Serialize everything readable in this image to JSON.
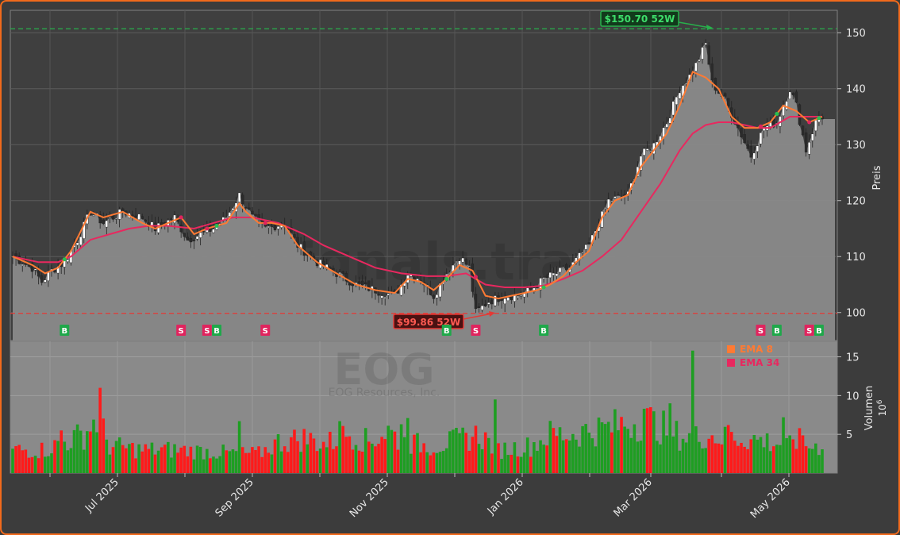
{
  "chart_data": {
    "type": "candlestick",
    "price_axis": {
      "label": "Preis",
      "ylim": [
        95,
        154
      ],
      "ticks": [
        100,
        110,
        120,
        130,
        140,
        150
      ]
    },
    "volume_axis": {
      "label": "Volumen",
      "exponent": "10",
      "exponent_power": "6",
      "ylim": [
        0,
        17
      ],
      "ticks": [
        5,
        10,
        15
      ]
    },
    "x_ticks": [
      "Jul 2025",
      "Sep 2025",
      "Nov 2025",
      "Jan 2026",
      "Mar 2026",
      "May 2026"
    ],
    "levels": {
      "high_52w": {
        "value": 150.7,
        "label": "$150.70 52W"
      },
      "low_52w": {
        "value": 99.86,
        "label": "$99.86 52W"
      }
    },
    "legend": [
      {
        "name": "EMA 8",
        "color": "#ff7a33"
      },
      {
        "name": "EMA 34",
        "color": "#e8285f"
      }
    ],
    "watermark": {
      "site": "forexsignals.trade",
      "ticker": "EOG",
      "company": "EOG Resources, Inc."
    },
    "signals": [
      {
        "type": "B",
        "index": 16
      },
      {
        "type": "S",
        "index": 52
      },
      {
        "type": "S",
        "index": 60
      },
      {
        "type": "B",
        "index": 63
      },
      {
        "type": "S",
        "index": 78
      },
      {
        "type": "B",
        "index": 134
      },
      {
        "type": "S",
        "index": 143
      },
      {
        "type": "B",
        "index": 164
      },
      {
        "type": "S",
        "index": 231
      },
      {
        "type": "B",
        "index": 236
      },
      {
        "type": "S",
        "index": 246
      },
      {
        "type": "B",
        "index": 249
      }
    ],
    "close_anchors": [
      [
        0,
        110
      ],
      [
        6,
        108
      ],
      [
        9,
        105.5
      ],
      [
        12,
        107.5
      ],
      [
        16,
        109
      ],
      [
        20,
        113
      ],
      [
        24,
        118
      ],
      [
        28,
        116
      ],
      [
        34,
        118
      ],
      [
        40,
        117
      ],
      [
        44,
        115
      ],
      [
        50,
        117
      ],
      [
        54,
        113
      ],
      [
        58,
        114
      ],
      [
        62,
        115
      ],
      [
        66,
        117
      ],
      [
        70,
        121
      ],
      [
        74,
        117
      ],
      [
        78,
        115
      ],
      [
        84,
        116
      ],
      [
        88,
        112
      ],
      [
        94,
        109
      ],
      [
        100,
        107
      ],
      [
        106,
        105
      ],
      [
        112,
        104
      ],
      [
        118,
        103
      ],
      [
        122,
        107
      ],
      [
        126,
        106
      ],
      [
        130,
        103
      ],
      [
        134,
        107
      ],
      [
        138,
        110
      ],
      [
        141,
        108
      ],
      [
        143,
        100
      ],
      [
        147,
        102
      ],
      [
        152,
        103
      ],
      [
        156,
        103
      ],
      [
        160,
        104
      ],
      [
        164,
        106
      ],
      [
        168,
        107
      ],
      [
        172,
        108
      ],
      [
        178,
        112
      ],
      [
        184,
        120
      ],
      [
        190,
        121
      ],
      [
        194,
        128
      ],
      [
        198,
        130
      ],
      [
        202,
        134
      ],
      [
        206,
        140
      ],
      [
        210,
        143
      ],
      [
        214,
        148
      ],
      [
        216,
        141
      ],
      [
        220,
        138
      ],
      [
        224,
        133
      ],
      [
        228,
        128
      ],
      [
        232,
        133
      ],
      [
        236,
        134
      ],
      [
        240,
        140
      ],
      [
        242,
        137
      ],
      [
        245,
        129
      ],
      [
        248,
        134
      ],
      [
        250,
        135
      ]
    ],
    "ema8": [
      [
        0,
        110
      ],
      [
        6,
        108.5
      ],
      [
        10,
        107
      ],
      [
        14,
        108
      ],
      [
        18,
        111
      ],
      [
        24,
        118
      ],
      [
        28,
        117
      ],
      [
        34,
        118
      ],
      [
        40,
        116
      ],
      [
        44,
        115
      ],
      [
        48,
        116
      ],
      [
        52,
        117
      ],
      [
        56,
        114
      ],
      [
        60,
        115
      ],
      [
        66,
        116
      ],
      [
        70,
        119.5
      ],
      [
        72,
        118
      ],
      [
        76,
        116
      ],
      [
        80,
        116
      ],
      [
        84,
        115.5
      ],
      [
        88,
        112
      ],
      [
        94,
        109
      ],
      [
        100,
        107
      ],
      [
        106,
        105
      ],
      [
        112,
        104
      ],
      [
        118,
        103.5
      ],
      [
        122,
        106
      ],
      [
        126,
        105.5
      ],
      [
        130,
        104
      ],
      [
        134,
        106
      ],
      [
        138,
        108.5
      ],
      [
        142,
        107.5
      ],
      [
        146,
        103
      ],
      [
        150,
        102.5
      ],
      [
        154,
        103
      ],
      [
        158,
        103.5
      ],
      [
        162,
        104
      ],
      [
        166,
        105
      ],
      [
        170,
        106.5
      ],
      [
        174,
        109
      ],
      [
        178,
        111
      ],
      [
        182,
        117
      ],
      [
        186,
        120
      ],
      [
        190,
        121
      ],
      [
        194,
        126
      ],
      [
        198,
        129
      ],
      [
        202,
        132
      ],
      [
        206,
        137
      ],
      [
        210,
        143
      ],
      [
        214,
        142
      ],
      [
        218,
        140
      ],
      [
        222,
        135
      ],
      [
        226,
        133
      ],
      [
        230,
        133
      ],
      [
        234,
        134
      ],
      [
        238,
        137
      ],
      [
        242,
        136
      ],
      [
        246,
        134
      ],
      [
        250,
        135
      ]
    ],
    "ema34": [
      [
        0,
        110
      ],
      [
        8,
        109
      ],
      [
        14,
        109
      ],
      [
        18,
        110
      ],
      [
        24,
        113
      ],
      [
        30,
        114
      ],
      [
        36,
        115
      ],
      [
        42,
        115.5
      ],
      [
        48,
        115.5
      ],
      [
        56,
        115
      ],
      [
        62,
        116
      ],
      [
        68,
        117
      ],
      [
        74,
        117
      ],
      [
        82,
        116
      ],
      [
        90,
        114
      ],
      [
        96,
        112
      ],
      [
        104,
        110
      ],
      [
        112,
        108
      ],
      [
        120,
        107
      ],
      [
        128,
        106.5
      ],
      [
        134,
        106.5
      ],
      [
        140,
        107
      ],
      [
        146,
        105
      ],
      [
        152,
        104.5
      ],
      [
        158,
        104.5
      ],
      [
        164,
        104.8
      ],
      [
        170,
        106
      ],
      [
        176,
        107.5
      ],
      [
        182,
        110
      ],
      [
        188,
        113
      ],
      [
        194,
        118
      ],
      [
        200,
        123
      ],
      [
        206,
        129
      ],
      [
        210,
        132
      ],
      [
        214,
        133.5
      ],
      [
        218,
        134
      ],
      [
        222,
        134
      ],
      [
        226,
        133.5
      ],
      [
        230,
        133
      ],
      [
        234,
        133
      ],
      [
        240,
        135
      ],
      [
        246,
        135
      ],
      [
        250,
        135
      ]
    ],
    "volume_anchors": [
      [
        0,
        3
      ],
      [
        10,
        3
      ],
      [
        16,
        4
      ],
      [
        22,
        5
      ],
      [
        26,
        7
      ],
      [
        30,
        3.5
      ],
      [
        40,
        3
      ],
      [
        50,
        3
      ],
      [
        60,
        2.8
      ],
      [
        70,
        2.5
      ],
      [
        76,
        2.5
      ],
      [
        82,
        4
      ],
      [
        90,
        4.5
      ],
      [
        96,
        3.8
      ],
      [
        100,
        4.2
      ],
      [
        104,
        5.2
      ],
      [
        110,
        4
      ],
      [
        116,
        5.5
      ],
      [
        120,
        4
      ],
      [
        130,
        3.5
      ],
      [
        140,
        4.5
      ],
      [
        144,
        5
      ],
      [
        150,
        3
      ],
      [
        160,
        3.5
      ],
      [
        166,
        5
      ],
      [
        172,
        5
      ],
      [
        178,
        5.5
      ],
      [
        184,
        5.8
      ],
      [
        190,
        6.5
      ],
      [
        196,
        6.8
      ],
      [
        200,
        6
      ],
      [
        206,
        4.8
      ],
      [
        210,
        4.5
      ],
      [
        214,
        5
      ],
      [
        220,
        4.5
      ],
      [
        226,
        4.5
      ],
      [
        232,
        4.2
      ],
      [
        240,
        3.5
      ],
      [
        250,
        3.5
      ]
    ],
    "volume_spikes": [
      [
        15,
        5.5
      ],
      [
        27,
        11
      ],
      [
        70,
        6.7
      ],
      [
        101,
        6.7
      ],
      [
        120,
        6.3
      ],
      [
        122,
        7.1
      ],
      [
        149,
        9.5
      ],
      [
        195,
        8.3
      ],
      [
        203,
        9
      ],
      [
        210,
        15.8
      ],
      [
        221,
        6.2
      ],
      [
        238,
        7.2
      ],
      [
        243,
        5.8
      ]
    ],
    "n_days": 251
  }
}
